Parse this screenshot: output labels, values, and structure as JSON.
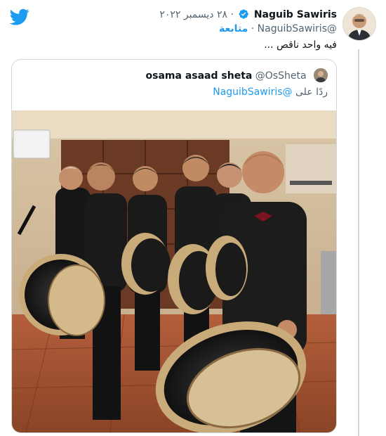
{
  "tweet": {
    "name": "Naguib Sawiris",
    "date": "٢٨ ديسمبر ٢٠٢٢",
    "separator": "·",
    "handle": "@NaguibSawiris",
    "follow_label": "متابعة",
    "text": "فيه واحد ناقص ..."
  },
  "quoted": {
    "name": "osama asaad sheta",
    "handle": "@OsSheta",
    "reply_prefix": "ردًا على",
    "reply_handle": "@NaguibSawiris"
  },
  "colors": {
    "brand": "#1d9bf0",
    "text": "#0f1419",
    "secondary": "#536471",
    "border": "#cfd9de"
  },
  "icons": {
    "logo": "twitter-bird-icon",
    "verified": "verified-badge-icon"
  }
}
